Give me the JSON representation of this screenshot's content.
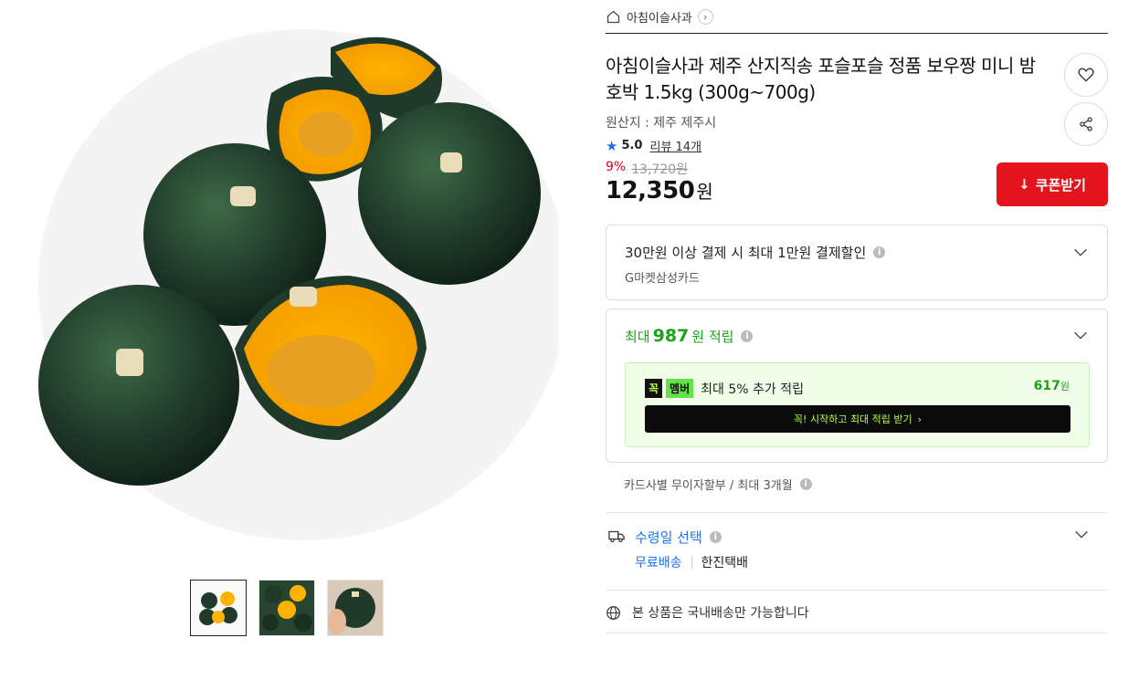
{
  "breadcrumb": {
    "icon": "home-icon",
    "shop_name": "아침이슬사과",
    "chevron": "›"
  },
  "product": {
    "title": "아침이슬사과 제주 산지직송 포슬포슬 정품 보우짱 미니 밤호박 1.5kg (300g~700g)",
    "origin": "원산지 : 제주 제주시",
    "rating": "5.0",
    "review_label": "리뷰 14개",
    "discount_rate": "9%",
    "original_price": "13,720원",
    "price": "12,350",
    "currency": "원"
  },
  "actions": {
    "coupon_label": "쿠폰받기",
    "like_icon": "heart-icon",
    "share_icon": "share-icon"
  },
  "card_discount": {
    "title": "30만원 이상 결제 시 최대 1만원 결제할인",
    "card_name": "G마켓삼성카드"
  },
  "points": {
    "prefix": "최대",
    "amount": "987",
    "suffix": "원 적립",
    "member_badge_1": "꼭",
    "member_badge_2": "멤버",
    "member_text": "최대 5% 추가 적립",
    "member_amount": "617",
    "member_amount_unit": "원",
    "cta": "꼭! 시작하고 최대 적립 받기",
    "cta_arrow": "›"
  },
  "installment": "카드사별 무이자할부 / 최대 3개월",
  "delivery": {
    "label": "수령일 선택",
    "shipping_fee": "무료배송",
    "courier": "한진택배"
  },
  "domestic_notice": "본 상품은 국내배송만 가능합니다",
  "thumbnails": 3,
  "colors": {
    "coupon_red": "#e4141f",
    "discount_red": "#e4002b",
    "green": "#19a319",
    "blue": "#1a73e8",
    "lime": "#b6ff4d"
  }
}
